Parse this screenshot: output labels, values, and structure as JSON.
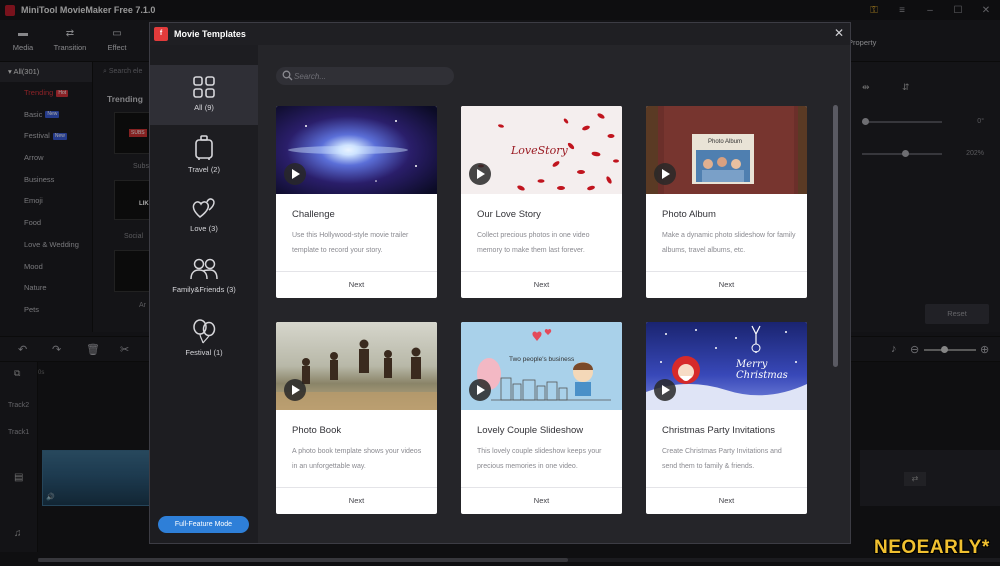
{
  "app": {
    "title": "MiniTool MovieMaker Free 7.1.0",
    "toolbar": [
      {
        "label": "Media",
        "icon": "folder-icon"
      },
      {
        "label": "Transition",
        "icon": "transition-icon"
      },
      {
        "label": "Effect",
        "icon": "effect-icon"
      }
    ],
    "property_tab": "Property"
  },
  "categories": {
    "all": "All(301)",
    "items": [
      {
        "label": "Trending",
        "badge": "Hot"
      },
      {
        "label": "Basic",
        "badge": "New"
      },
      {
        "label": "Festival",
        "badge": "New"
      },
      {
        "label": "Arrow",
        "badge": ""
      },
      {
        "label": "Business",
        "badge": ""
      },
      {
        "label": "Emoji",
        "badge": ""
      },
      {
        "label": "Food",
        "badge": ""
      },
      {
        "label": "Love & Wedding",
        "badge": ""
      },
      {
        "label": "Mood",
        "badge": ""
      },
      {
        "label": "Nature",
        "badge": ""
      },
      {
        "label": "Pets",
        "badge": ""
      }
    ]
  },
  "library": {
    "search_placeholder": "Search ele",
    "heading": "Trending",
    "stub_labels": [
      "Subs",
      "Social",
      "Ar",
      "SUBS",
      "LIK"
    ]
  },
  "properties": {
    "value1": "0°",
    "value2": "202%",
    "reset": "Reset"
  },
  "timeline": {
    "tracks": [
      "Track2",
      "Track1"
    ],
    "time": "0s"
  },
  "modal": {
    "title": "Movie Templates",
    "logo": "f",
    "search_placeholder": "Search...",
    "full_feature_button": "Full-Feature Mode",
    "categories": [
      {
        "label": "All",
        "count": "(9)",
        "icon": "grid-icon"
      },
      {
        "label": "Travel",
        "count": "(2)",
        "icon": "suitcase-icon"
      },
      {
        "label": "Love",
        "count": "(3)",
        "icon": "hearts-icon"
      },
      {
        "label": "Family&Friends",
        "count": "(3)",
        "icon": "people-icon"
      },
      {
        "label": "Festival",
        "count": "(1)",
        "icon": "balloons-icon"
      }
    ],
    "cards": [
      {
        "title": "Challenge",
        "desc": "Use this Hollywood-style movie trailer template to record your story.",
        "next": "Next"
      },
      {
        "title": "Our Love Story",
        "desc": "Collect precious photos in one video memory to make them last forever.",
        "next": "Next",
        "image_text": "LoveStory"
      },
      {
        "title": "Photo Album",
        "desc": "Make a dynamic photo slideshow for family albums, travel albums, etc.",
        "next": "Next",
        "image_text": "Photo Album"
      },
      {
        "title": "Photo Book",
        "desc": "A photo book template shows your videos in an unforgettable way.",
        "next": "Next"
      },
      {
        "title": "Lovely Couple Slideshow",
        "desc": "This lovely couple slideshow keeps your precious memories in one video.",
        "next": "Next",
        "image_text": "Two people's business"
      },
      {
        "title": "Christmas Party Invitations",
        "desc": "Create Christmas Party Invitations and send them to family & friends.",
        "next": "Next",
        "image_text": "Merry Christmas"
      }
    ]
  },
  "watermark": "NEOEARLY*",
  "colors": {
    "accent_blue": "#2e7fd8",
    "hot_red": "#d6343b",
    "modal_bg": "#252529",
    "card_bg": "#ffffff"
  }
}
